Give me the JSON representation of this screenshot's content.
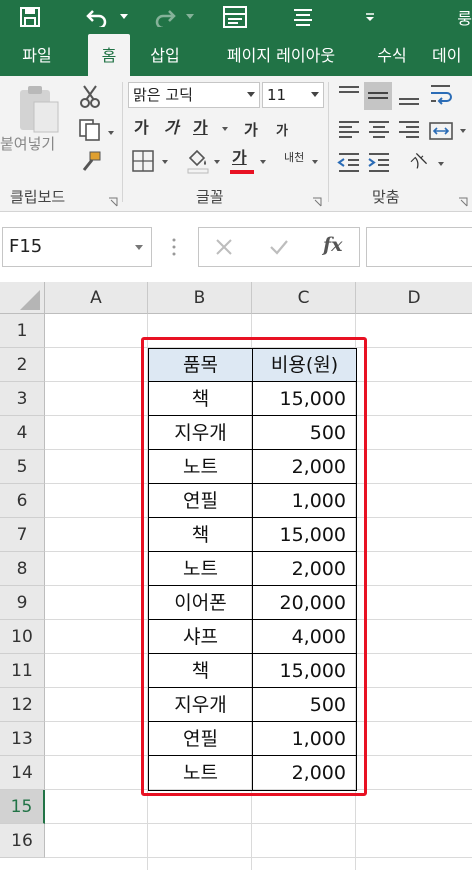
{
  "title_bar": {
    "title_fragment": "룽"
  },
  "tabs": [
    {
      "label": "파일"
    },
    {
      "label": "홈"
    },
    {
      "label": "삽입"
    },
    {
      "label": "페이지 레이아웃"
    },
    {
      "label": "수식"
    },
    {
      "label": "데이"
    }
  ],
  "active_tab": "홈",
  "ribbon": {
    "clipboard": {
      "paste_label": "붙여넣기",
      "group_label": "클립보드"
    },
    "font": {
      "font_name": "맑은 고딕",
      "font_size": "11",
      "bold": "가",
      "italic": "가",
      "underline": "가",
      "grow_font": "가",
      "shrink_font": "가",
      "font_color_glyph": "가",
      "phonetic": "내천",
      "group_label": "글꼴",
      "font_color": "#e81123"
    },
    "alignment": {
      "group_label": "맞춤",
      "orientation_glyph": "가"
    }
  },
  "formula_bar": {
    "name_box": "F15",
    "fx_label": "fx",
    "formula": ""
  },
  "columns": [
    "A",
    "B",
    "C",
    "D"
  ],
  "rows": [
    "1",
    "2",
    "3",
    "4",
    "5",
    "6",
    "7",
    "8",
    "9",
    "10",
    "11",
    "12",
    "13",
    "14",
    "15",
    "16"
  ],
  "selected_row": "15",
  "table": {
    "headers": [
      "품목",
      "비용(원)"
    ],
    "rows": [
      [
        "책",
        "15,000"
      ],
      [
        "지우개",
        "500"
      ],
      [
        "노트",
        "2,000"
      ],
      [
        "연필",
        "1,000"
      ],
      [
        "책",
        "15,000"
      ],
      [
        "노트",
        "2,000"
      ],
      [
        "이어폰",
        "20,000"
      ],
      [
        "샤프",
        "4,000"
      ],
      [
        "책",
        "15,000"
      ],
      [
        "지우개",
        "500"
      ],
      [
        "연필",
        "1,000"
      ],
      [
        "노트",
        "2,000"
      ]
    ]
  },
  "colors": {
    "excel_green": "#217346",
    "header_fill": "#dde8f3",
    "highlight_border": "#e81123"
  }
}
